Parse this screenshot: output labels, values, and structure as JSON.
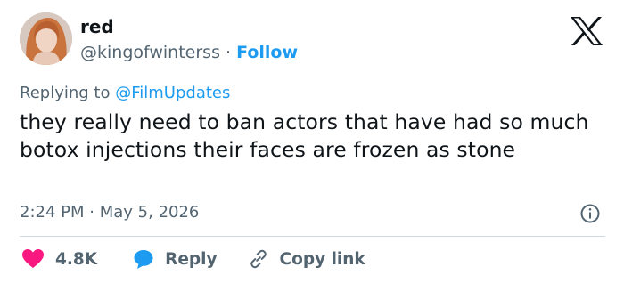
{
  "user": {
    "name": "red",
    "handle": "@kingofwinterss",
    "separator": "·",
    "follow_label": "Follow"
  },
  "reply": {
    "prefix": "Replying to",
    "mention": "@FilmUpdates"
  },
  "tweet": {
    "text": "they really need to ban actors that have had so much botox injections their faces are frozen as stone"
  },
  "meta": {
    "time": "2:24 PM",
    "separator": "·",
    "date": "May 5, 2026"
  },
  "actions": {
    "likes_count": "4.8K",
    "reply_label": "Reply",
    "copy_link_label": "Copy link"
  },
  "colors": {
    "accent": "#1d9bf0",
    "like": "#f91880",
    "muted": "#536471",
    "text": "#0f1419",
    "divider": "#cfd9de"
  },
  "icons": [
    "x-logo-icon",
    "info-icon",
    "heart-icon",
    "speech-bubble-icon",
    "link-icon"
  ]
}
